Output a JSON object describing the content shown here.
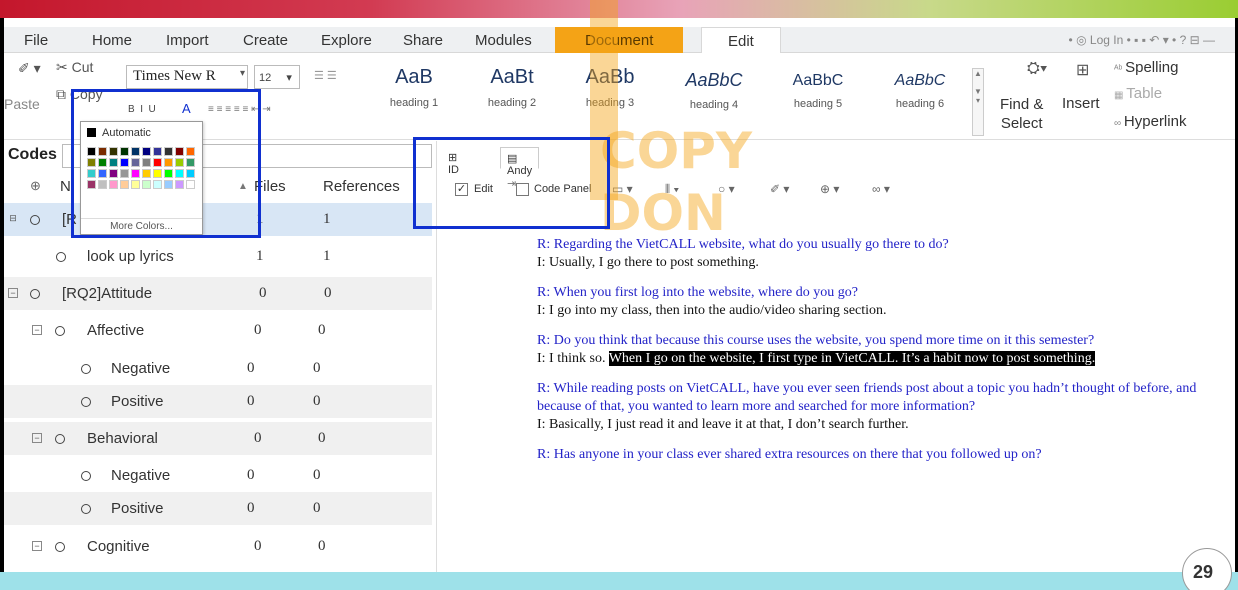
{
  "menu": {
    "file": "File",
    "home": "Home",
    "import": "Import",
    "create": "Create",
    "explore": "Explore",
    "share": "Share",
    "modules": "Modules",
    "document": "Document",
    "edit": "Edit",
    "login": "Log In"
  },
  "ribbon": {
    "cut": "Cut",
    "copy": "Copy",
    "paste": "Paste",
    "font_name": "Times New R",
    "font_size": "12",
    "styles": [
      {
        "sample": "AaB",
        "label": "heading 1"
      },
      {
        "sample": "AaBt",
        "label": "heading 2"
      },
      {
        "sample": "AaBb",
        "label": "heading 3"
      },
      {
        "sample": "AaBbC",
        "label": "heading 4"
      },
      {
        "sample": "AaBbC",
        "label": "heading 5"
      },
      {
        "sample": "AaBbC",
        "label": "heading 6"
      }
    ],
    "find_select_1": "Find &",
    "find_select_2": "Select",
    "insert": "Insert",
    "spelling": "Spelling",
    "table": "Table",
    "hyperlink": "Hyperlink"
  },
  "color_picker": {
    "automatic": "Automatic",
    "more_colors": "More Colors..."
  },
  "codes": {
    "title": "Codes",
    "col_name": "N",
    "col_files": "Files",
    "col_refs": "References",
    "rows": [
      {
        "name": "[R",
        "files": "1",
        "refs": "1"
      },
      {
        "name": "look up lyrics",
        "files": "1",
        "refs": "1"
      },
      {
        "name": "[RQ2]Attitude",
        "files": "0",
        "refs": "0"
      },
      {
        "name": "Affective",
        "files": "0",
        "refs": "0"
      },
      {
        "name": "Negative",
        "files": "0",
        "refs": "0"
      },
      {
        "name": "Positive",
        "files": "0",
        "refs": "0"
      },
      {
        "name": "Behavioral",
        "files": "0",
        "refs": "0"
      },
      {
        "name": "Negative",
        "files": "0",
        "refs": "0"
      },
      {
        "name": "Positive",
        "files": "0",
        "refs": "0"
      },
      {
        "name": "Cognitive",
        "files": "0",
        "refs": "0"
      }
    ]
  },
  "doc": {
    "tab_id": "ID",
    "tab_andy": "Andy",
    "edit_label": "Edit",
    "code_panel_label": "Code Panel"
  },
  "transcript": {
    "r1": "R: Regarding the VietCALL website, what do you usually go there to do?",
    "i1": "I: Usually, I go there to post something.",
    "r2": "R: When you first log into the website, where do you go?",
    "i2": "I: I go into my class, then into the audio/video sharing section.",
    "r3": "R: Do you think that because this course uses the website, you spend more time on it this semester?",
    "i3a": "I: I think so.",
    "i3b": "When I go on the website, I first type in VietCALL. It’s a habit now to post something.",
    "r4": "R: While reading posts on VietCALL, have you ever seen friends post about a topic you hadn’t thought of before, and because of that, you wanted to learn more and searched for more information?",
    "i4": "I: Basically, I just read it and leave it at that, I don’t search further.",
    "r5": "R: Has anyone in your class ever shared extra resources on there that you followed up on?"
  },
  "watermark": "COPY DON",
  "page_number": "29"
}
